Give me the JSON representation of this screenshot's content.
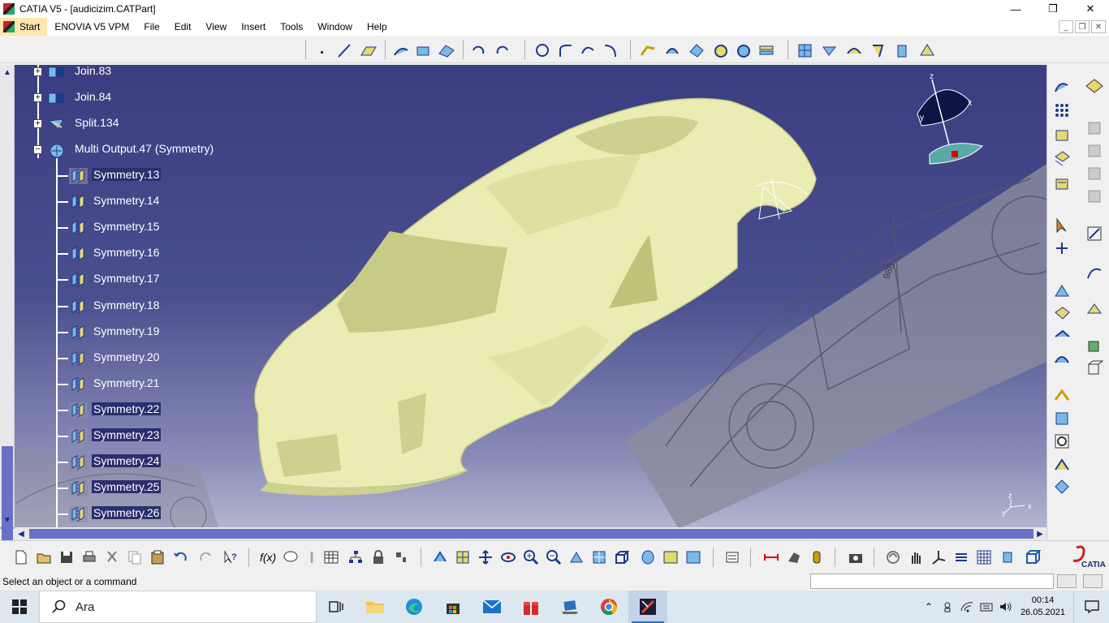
{
  "window": {
    "title": "CATIA V5 - [audicizim.CATPart]",
    "controls": [
      "—",
      "❐",
      "✕"
    ]
  },
  "menubar": {
    "items": [
      "Start",
      "ENOVIA V5 VPM",
      "File",
      "Edit",
      "View",
      "Insert",
      "Tools",
      "Window",
      "Help"
    ],
    "mdi_controls": [
      "_",
      "❐",
      "✕"
    ]
  },
  "tree": {
    "nodes": [
      {
        "label": "Join.83",
        "icon": "join-icon",
        "expander": "+"
      },
      {
        "label": "Join.84",
        "icon": "join-icon",
        "expander": "+"
      },
      {
        "label": "Split.134",
        "icon": "split-icon",
        "expander": "+"
      },
      {
        "label": "Multi Output.47 (Symmetry)",
        "icon": "multi-output-icon",
        "expander": "−"
      },
      {
        "label": "Symmetry.13",
        "icon": "symmetry-icon",
        "selected": true
      },
      {
        "label": "Symmetry.14",
        "icon": "symmetry-icon"
      },
      {
        "label": "Symmetry.15",
        "icon": "symmetry-icon"
      },
      {
        "label": "Symmetry.16",
        "icon": "symmetry-icon"
      },
      {
        "label": "Symmetry.17",
        "icon": "symmetry-icon"
      },
      {
        "label": "Symmetry.18",
        "icon": "symmetry-icon"
      },
      {
        "label": "Symmetry.19",
        "icon": "symmetry-icon"
      },
      {
        "label": "Symmetry.20",
        "icon": "symmetry-icon"
      },
      {
        "label": "Symmetry.21",
        "icon": "symmetry-icon"
      },
      {
        "label": "Symmetry.22",
        "icon": "symmetry-icon",
        "selected": true
      },
      {
        "label": "Symmetry.23",
        "icon": "symmetry-icon",
        "selected": true
      },
      {
        "label": "Symmetry.24",
        "icon": "symmetry-icon",
        "selected": true
      },
      {
        "label": "Symmetry.25",
        "icon": "symmetry-icon",
        "selected": true
      },
      {
        "label": "Symmetry.26",
        "icon": "symmetry-icon",
        "selected": true
      }
    ]
  },
  "viewport": {
    "compass_labels": {
      "z": "z",
      "x": "x",
      "y": "y"
    },
    "axis_labels": {
      "z": "z",
      "x": "x",
      "y": "y"
    },
    "blueprint_dimension": "986",
    "colors": {
      "background_top": "#3a3d80",
      "background_bottom": "#b4b6d0",
      "car_body": "#eaecb4",
      "selection": "#2b2f6e"
    }
  },
  "bottom_toolbar": {
    "brand": "CATIA"
  },
  "status": {
    "message": "Select an object or a command",
    "command_input": ""
  },
  "taskbar": {
    "search_placeholder": "Ara",
    "time": "00:14",
    "date": "26.05.2021",
    "apps": [
      "task-view",
      "file-explorer",
      "edge",
      "store",
      "mail",
      "gift",
      "laptop",
      "chrome",
      "catia"
    ]
  }
}
